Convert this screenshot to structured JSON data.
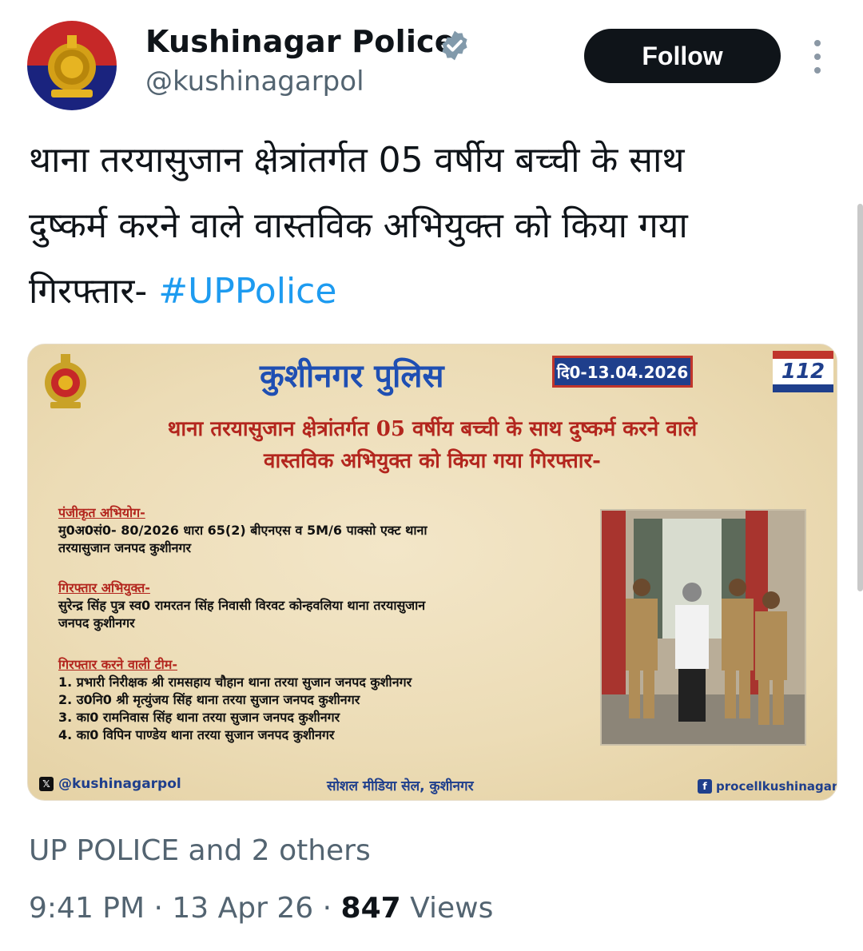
{
  "header": {
    "display_name": "Kushinagar Police",
    "handle": "@kushinagarpol",
    "follow_label": "Follow"
  },
  "tweet": {
    "lines": [
      "थाना तरयासुजान क्षेत्रांतर्गत 05 वर्षीय बच्ची के साथ",
      "दुष्कर्म करने वाले वास्तविक अभियुक्त को किया गया",
      "गिरफ्तार-"
    ],
    "hashtag": "#UPPolice"
  },
  "media": {
    "title": "कुशीनगर पुलिस",
    "date": "दि0-13.04.2026",
    "badge_112": "112",
    "heading_line1": "थाना तरयासुजान क्षेत्रांतर्गत 05 वर्षीय बच्ची के साथ दुष्कर्म करने वाले",
    "heading_line2": "वास्तविक अभियुक्त को किया गया गिरफ्तार-",
    "case_label": "पंजीकृत अभियोग-",
    "case_lines": [
      "मु0अ0सं0- 80/2026 धारा 65(2) बीएनएस व 5M/6 पाक्सो एक्ट थाना",
      "तरयासुजान जनपद कुशीनगर"
    ],
    "accused_label": "गिरफ्तार अभियुक्त-",
    "accused_lines": [
      "सुरेन्द्र सिंह पुत्र स्व0 रामरतन सिंह निवासी विरवट कोन्हवलिया थाना तरयासुजान",
      "जनपद कुशीनगर"
    ],
    "team_label": "गिरफ्तार करने वाली टीम-",
    "team_lines": [
      "1. प्रभारी निरीक्षक श्री रामसहाय चौहान थाना तरया सुजान जनपद कुशीनगर",
      "2. उ0नि0 श्री मृत्युंजय सिंह थाना तरया सुजान जनपद कुशीनगर",
      "3. का0 रामनिवास सिंह थाना तरया सुजान जनपद कुशीनगर",
      "4. का0 विपिन पाण्डेय थाना तरया सुजान जनपद कुशीनगर"
    ],
    "footer_left": "@kushinagarpol",
    "footer_center": "सोशल मीडिया सेल, कुशीनगर",
    "footer_right": "procellkushinagar"
  },
  "liked_by": "UP POLICE and 2 others",
  "meta": {
    "time": "9:41 PM",
    "date": "13 Apr 26",
    "views_count": "847",
    "views_label": "Views"
  },
  "colors": {
    "hashtag": "#1d9bf0",
    "poster_title": "#1f4fb3",
    "poster_heading": "#b3261e",
    "follow_bg": "#0f1419",
    "verified": "#829aab"
  },
  "icons": [
    "police-emblem-icon",
    "verified-badge-icon",
    "more-options-icon",
    "x-logo-icon",
    "facebook-icon"
  ]
}
